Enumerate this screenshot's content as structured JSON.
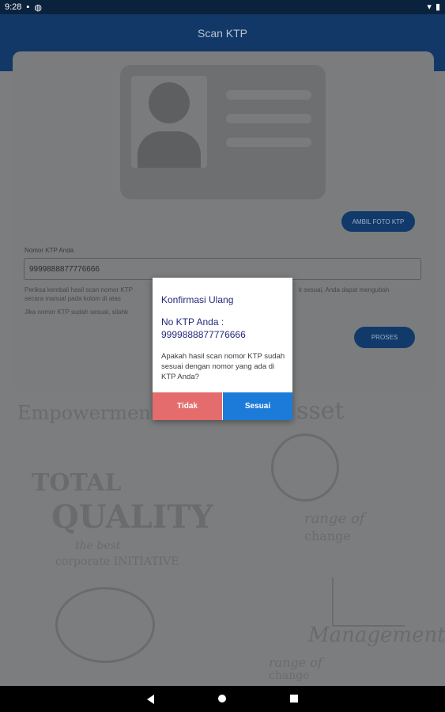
{
  "status_bar": {
    "time": "9:28"
  },
  "app_bar": {
    "title": "Scan KTP"
  },
  "form": {
    "ambil_button": "AMBIL FOTO KTP",
    "ktp_label": "Nomor KTP Anda",
    "ktp_value": "9999888877776666",
    "help_line1": "Periksa kembali hasil scan nomor KTP",
    "help_line1_end": "k sesuai, Anda dapat mengubah",
    "help_line2": "secara manual pada kolom di atas",
    "help_line3": "Jika nomor KTP sudah sesuai, silahk",
    "proses_button": "PROSES"
  },
  "background_text": {
    "empowerment": "Empowerment",
    "asset": "sset",
    "total": "TOTAL",
    "quality": "QUALITY",
    "best": "the best",
    "corporate": "corporate INITIATIVE",
    "range": "range of",
    "change": "change",
    "management": "Management",
    "range2": "range of",
    "change2": "change"
  },
  "dialog": {
    "title": "Konfirmasi Ulang",
    "heading_line1": "No KTP Anda :",
    "heading_line2": "9999888877776666",
    "message": "Apakah hasil scan nomor KTP sudah sesuai dengan nomor yang ada di KTP Anda?",
    "cancel_label": "Tidak",
    "confirm_label": "Sesuai"
  },
  "colors": {
    "app_bar": "#123867",
    "cancel": "#e46c6c",
    "confirm": "#1c7bd8"
  }
}
